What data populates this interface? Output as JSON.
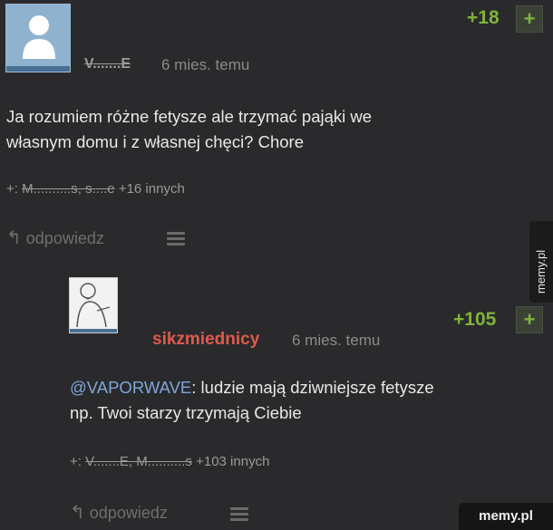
{
  "comment1": {
    "author": "V.......E",
    "time": "6 mies. temu",
    "score": "+18",
    "vote_label": "+",
    "body_line1": "Ja rozumiem różne fetysze ale trzymać pająki we",
    "body_line2": "własnym domu i z własnej chęci? Chore",
    "likes_prefix": "+:",
    "likes_names": "M..........s, s....e",
    "likes_suffix": "+16 innych",
    "reply_label": "odpowiedz"
  },
  "comment2": {
    "author": "sikzmiednicy",
    "time": "6 mies. temu",
    "score": "+105",
    "vote_label": "+",
    "mention": "@VAPORWAVE",
    "body_line1_rest": ": ludzie mają dziwniejsze fetysze",
    "body_line2": "np. Twoi starzy trzymają Ciebie",
    "likes_prefix": "+:",
    "likes_names": "V.......E, M..........s",
    "likes_suffix": "+103 innych",
    "reply_label": "odpowiedz"
  },
  "watermark": {
    "side": "memy.pl",
    "corner": "memy.pl"
  },
  "colors": {
    "background": "#2a2a2c",
    "score_green": "#7fb33a",
    "author_red": "#e05a4b",
    "mention_blue": "#7fa6d8"
  }
}
